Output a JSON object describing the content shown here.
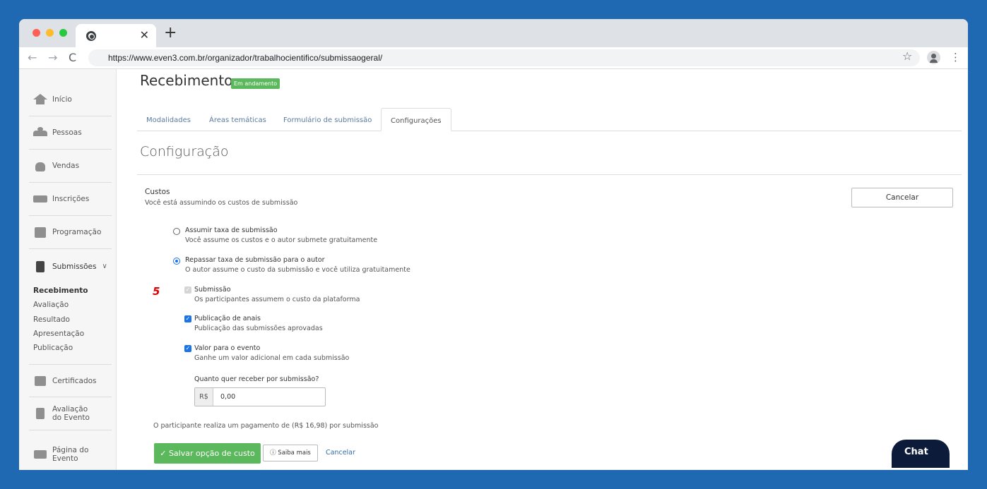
{
  "browser": {
    "url": "https://www.even3.com.br/organizador/trabalhocientifico/submissaogeral/",
    "new_tab": "+",
    "close_tab": "✕"
  },
  "sidebar": {
    "items": [
      {
        "label": "Início",
        "icon": "home-icon"
      },
      {
        "label": "Pessoas",
        "icon": "people-icon"
      },
      {
        "label": "Vendas",
        "icon": "money-bag-icon"
      },
      {
        "label": "Inscrições",
        "icon": "ticket-icon"
      },
      {
        "label": "Programação",
        "icon": "calendar-icon"
      },
      {
        "label": "Submissões",
        "icon": "document-icon"
      },
      {
        "label": "Certificados",
        "icon": "certificate-icon"
      },
      {
        "label_1": "Avaliação",
        "label_2": "do Evento",
        "icon": "clipboard-icon"
      },
      {
        "label_1": "Página do",
        "label_2": "Evento",
        "icon": "webpage-icon"
      }
    ],
    "sub_links": [
      "Recebimento",
      "Avaliação",
      "Resultado",
      "Apresentação",
      "Publicação"
    ]
  },
  "page": {
    "title": "Recebimento",
    "badge": "Em andamento"
  },
  "tabs": [
    "Modalidades",
    "Áreas temáticas",
    "Formulário de submissão",
    "Configurações"
  ],
  "config": {
    "title": "Configuração",
    "custos_heading": "Custos",
    "custos_desc": "Você está assumindo os custos de submissão",
    "cancel_button": "Cancelar"
  },
  "options": {
    "assumir": {
      "label": "Assumir taxa de submissão",
      "desc": "Você assume os custos e o autor submete gratuitamente",
      "selected": false
    },
    "repassar": {
      "label": "Repassar taxa de submissão para o autor",
      "desc": "O autor assume o custo da submissão e você utiliza gratuitamente",
      "selected": true
    },
    "submissao": {
      "label": "Submissão",
      "desc": "Os participantes assumem o custo da plataforma",
      "checked": true,
      "disabled": true
    },
    "publicacao": {
      "label": "Publicação de anais",
      "desc": "Publicação das submissões aprovadas",
      "checked": true
    },
    "valor": {
      "label": "Valor para o evento",
      "desc": "Ganhe um valor adicional em cada submissão",
      "checked": true
    }
  },
  "step_marker": "5",
  "amount": {
    "question": "Quanto quer receber por submissão?",
    "currency": "R$",
    "value": "0,00"
  },
  "payment_info": "O participante realiza um pagamento de (R$ 16,98) por submissão",
  "actions": {
    "save": "✓ Salvar opção de custo",
    "more": "ⓘ Saiba mais",
    "cancel": "Cancelar"
  },
  "chat_label": "Chat"
}
